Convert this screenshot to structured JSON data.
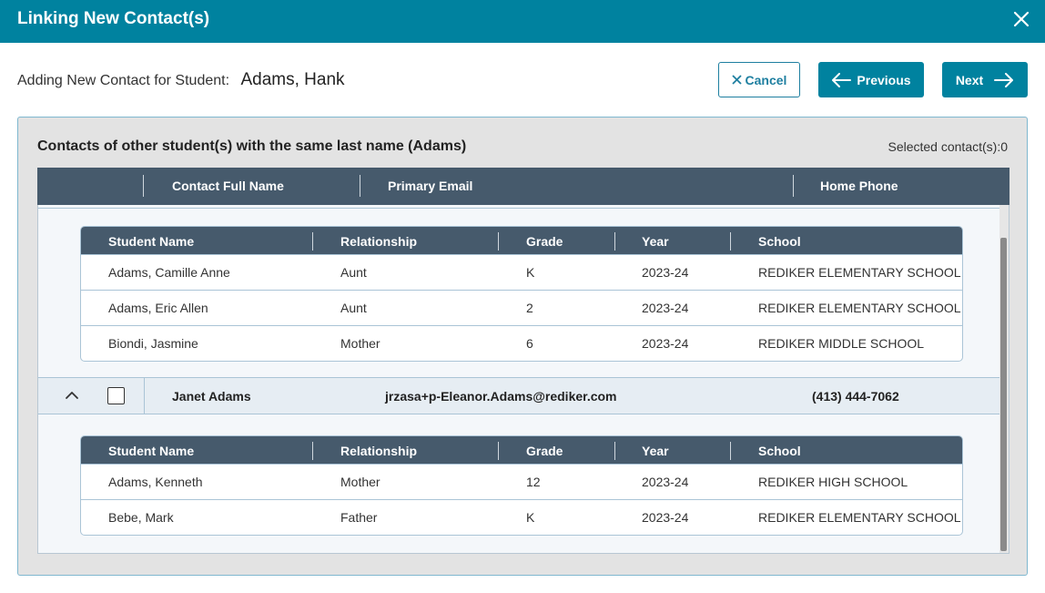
{
  "dialog": {
    "title": "Linking New Contact(s)"
  },
  "header": {
    "adding_label": "Adding New Contact for Student:",
    "student_name": "Adams, Hank"
  },
  "buttons": {
    "cancel": "Cancel",
    "previous": "Previous",
    "next": "Next"
  },
  "panel": {
    "title": "Contacts of other student(s) with the same last name (Adams)",
    "selected_label": "Selected contact(s):0"
  },
  "main_columns": {
    "full_name": "Contact Full Name",
    "email": "Primary Email",
    "phone": "Home Phone"
  },
  "sub_columns": {
    "student": "Student Name",
    "relationship": "Relationship",
    "grade": "Grade",
    "year": "Year",
    "school": "School"
  },
  "groups": [
    {
      "rows": [
        {
          "student": "Adams, Camille Anne",
          "relationship": "Aunt",
          "grade": "K",
          "year": "2023-24",
          "school": "REDIKER ELEMENTARY SCHOOL"
        },
        {
          "student": "Adams, Eric Allen",
          "relationship": "Aunt",
          "grade": "2",
          "year": "2023-24",
          "school": "REDIKER ELEMENTARY SCHOOL"
        },
        {
          "student": "Biondi, Jasmine",
          "relationship": "Mother",
          "grade": "6",
          "year": "2023-24",
          "school": "REDIKER MIDDLE SCHOOL"
        }
      ]
    },
    {
      "contact": {
        "name": "Janet Adams",
        "email": "jrzasa+p-Eleanor.Adams@rediker.com",
        "phone": "(413) 444-7062"
      },
      "rows": [
        {
          "student": "Adams, Kenneth",
          "relationship": "Mother",
          "grade": "12",
          "year": "2023-24",
          "school": "REDIKER HIGH SCHOOL"
        },
        {
          "student": "Bebe, Mark",
          "relationship": "Father",
          "grade": "K",
          "year": "2023-24",
          "school": "REDIKER ELEMENTARY SCHOOL"
        }
      ]
    }
  ],
  "icons": {
    "close": "close-icon",
    "cancel": "x-icon",
    "previous": "arrow-left-icon",
    "next": "arrow-right-icon",
    "collapse": "chevron-up-icon"
  },
  "colors": {
    "brand": "#00829f",
    "header": "#465a6c",
    "panel_bg": "#e3e3e3"
  }
}
